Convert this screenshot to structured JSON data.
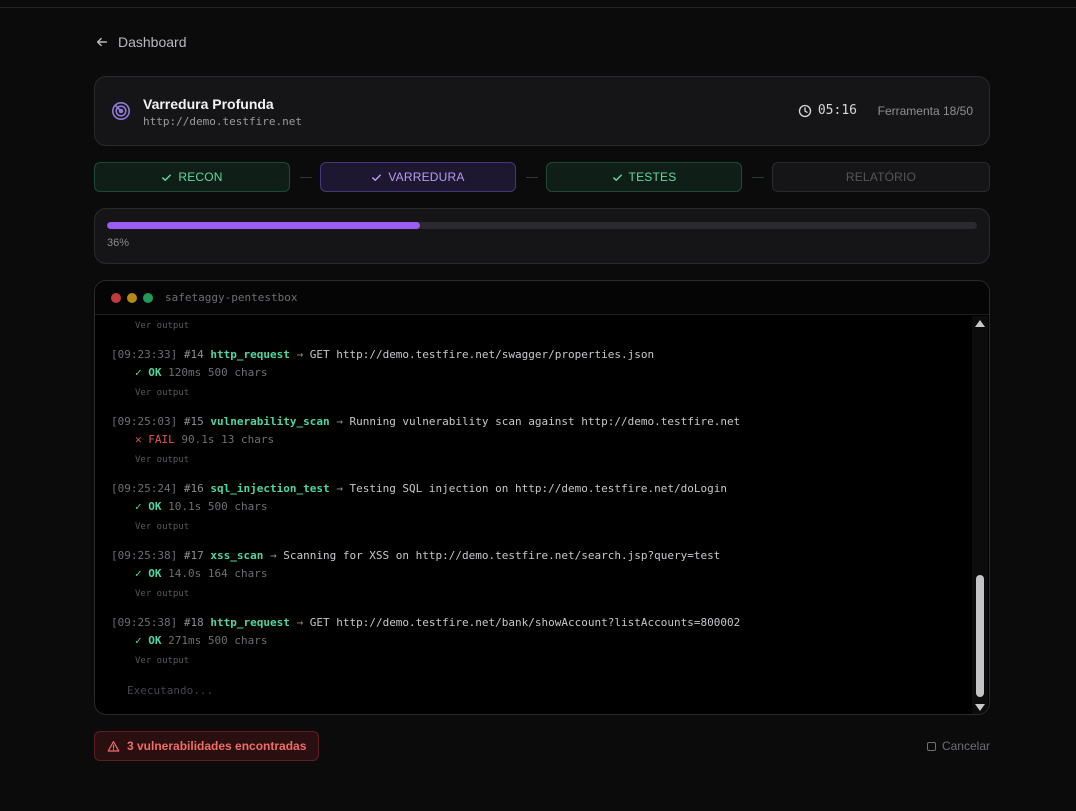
{
  "nav": {
    "back_label": "Dashboard"
  },
  "scan": {
    "title": "Varredura Profunda",
    "target": "http://demo.testfire.net",
    "elapsed": "05:16",
    "tool_progress": "Ferramenta 18/50"
  },
  "phases": [
    {
      "label": "RECON",
      "state": "done"
    },
    {
      "label": "VARREDURA",
      "state": "active"
    },
    {
      "label": "TESTES",
      "state": "done"
    },
    {
      "label": "RELATÓRIO",
      "state": "pending"
    }
  ],
  "progress": {
    "value": 0.36,
    "label": "36%"
  },
  "terminal": {
    "title": "safetaggy-pentestbox",
    "view_output_label": "Ver output",
    "running_label": "Executando...",
    "entries": [
      {
        "time": "[09:23:33]",
        "num": "#14",
        "tool": "http_request",
        "arrow": "→",
        "desc": "GET http://demo.testfire.net/swagger/properties.json",
        "status": "OK",
        "duration": "120ms",
        "size": "500 chars"
      },
      {
        "time": "[09:25:03]",
        "num": "#15",
        "tool": "vulnerability_scan",
        "arrow": "→",
        "desc": "Running vulnerability scan against http://demo.testfire.net",
        "status": "FAIL",
        "duration": "90.1s",
        "size": "13 chars"
      },
      {
        "time": "[09:25:24]",
        "num": "#16",
        "tool": "sql_injection_test",
        "arrow": "→",
        "desc": "Testing SQL injection on http://demo.testfire.net/doLogin",
        "status": "OK",
        "duration": "10.1s",
        "size": "500 chars"
      },
      {
        "time": "[09:25:38]",
        "num": "#17",
        "tool": "xss_scan",
        "arrow": "→",
        "desc": "Scanning for XSS on http://demo.testfire.net/search.jsp?query=test",
        "status": "OK",
        "duration": "14.0s",
        "size": "164 chars"
      },
      {
        "time": "[09:25:38]",
        "num": "#18",
        "tool": "http_request",
        "arrow": "→",
        "desc": "GET http://demo.testfire.net/bank/showAccount?listAccounts=800002",
        "status": "OK",
        "duration": "271ms",
        "size": "500 chars"
      }
    ]
  },
  "footer": {
    "vuln_label": "3 vulnerabilidades encontradas",
    "cancel_label": "Cancelar"
  },
  "colors": {
    "accent": "#9b5cf0",
    "success": "#4fd6a0",
    "danger": "#e5554f",
    "dot_red": "#c33a3a",
    "dot_yellow": "#b38a14",
    "dot_green": "#1f9a5a"
  }
}
